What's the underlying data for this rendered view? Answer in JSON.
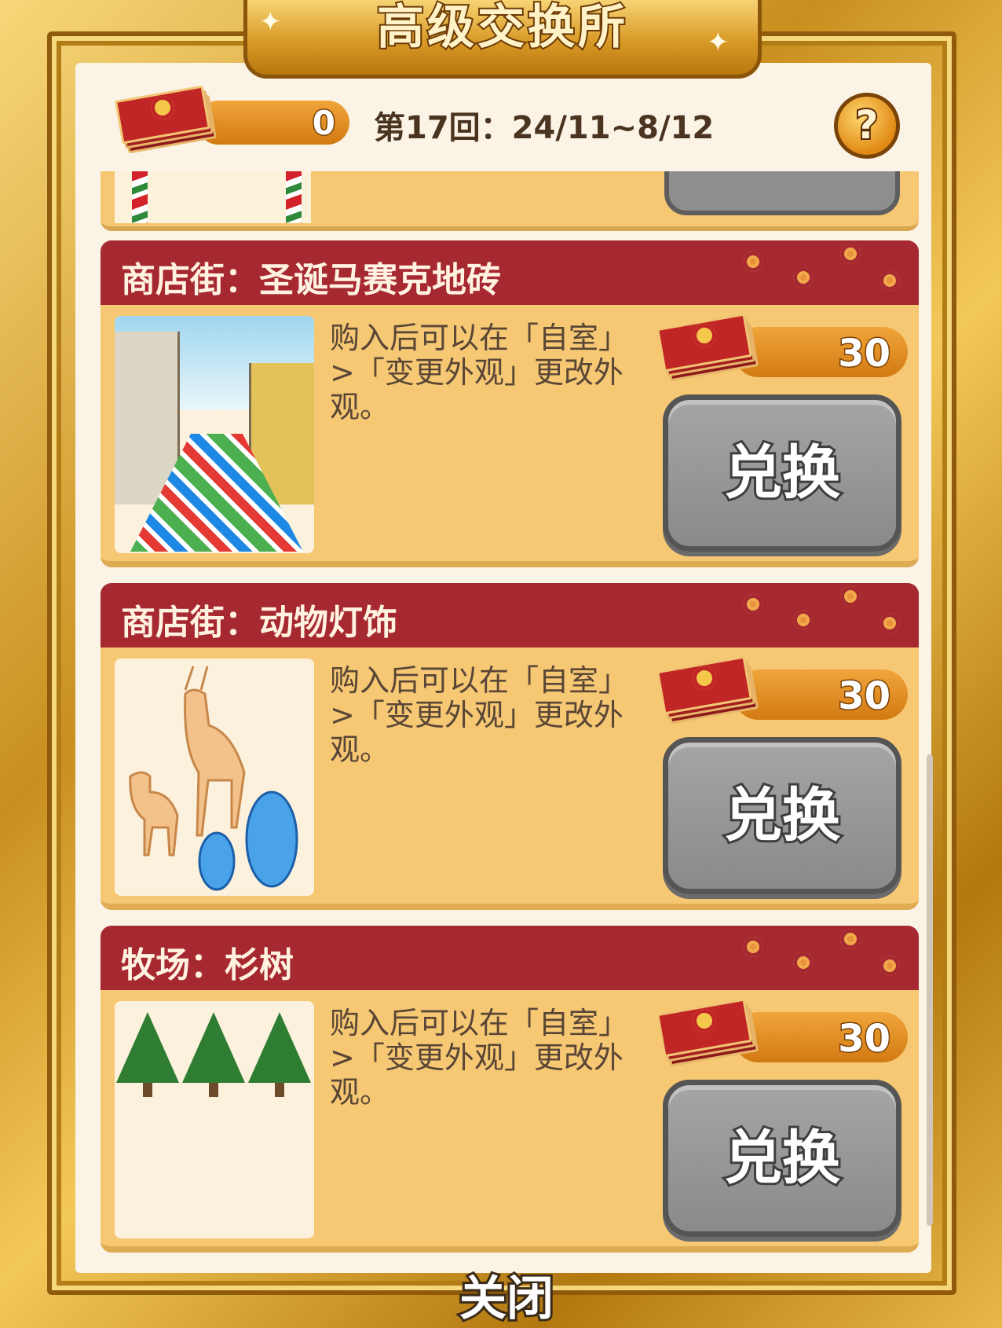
{
  "header": {
    "title": "高级交换所",
    "ticket_count": "0",
    "round": "第17回：24/11~8/12",
    "help_label": "?"
  },
  "items": [
    {
      "title": "商店街：圣诞马赛克地砖",
      "description": "购入后可以在「自室」>「变更外观」更改外观。",
      "price": "30",
      "button_label": "兑换"
    },
    {
      "title": "商店街：动物灯饰",
      "description": "购入后可以在「自室」>「变更外观」更改外观。",
      "price": "30",
      "button_label": "兑换"
    },
    {
      "title": "牧场：杉树",
      "description": "购入后可以在「自室」>「变更外观」更改外观。",
      "price": "30",
      "button_label": "兑换"
    }
  ],
  "footer": {
    "close_label": "关闭"
  },
  "colors": {
    "header_red": "#a62830",
    "card_bg": "#f6c874",
    "button_gray": "#8e8e8e",
    "gold": "#d99a27"
  }
}
